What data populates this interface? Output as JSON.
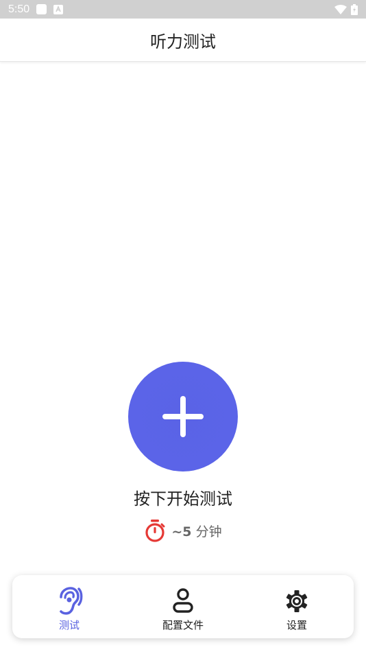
{
  "status_bar": {
    "time": "5:50"
  },
  "app_bar": {
    "title": "听力测试"
  },
  "main": {
    "start_button_icon": "plus-icon",
    "start_text": "按下开始测试",
    "duration_icon": "stopwatch-icon",
    "duration_prefix": "~5",
    "duration_unit": "分钟"
  },
  "bottom_nav": {
    "items": [
      {
        "label": "测试",
        "icon": "ear-icon",
        "active": true
      },
      {
        "label": "配置文件",
        "icon": "person-icon",
        "active": false
      },
      {
        "label": "设置",
        "icon": "gear-icon",
        "active": false
      }
    ]
  },
  "colors": {
    "accent": "#5A62E0",
    "stopwatch": "#E53935",
    "status_bar_bg": "#D0D0D0"
  }
}
